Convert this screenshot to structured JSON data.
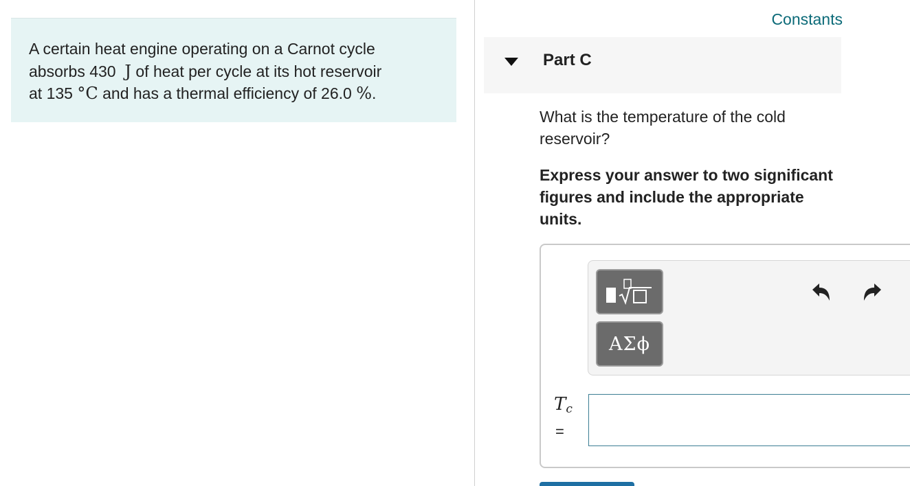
{
  "problem": {
    "line1": "A certain heat engine operating on a Carnot cycle",
    "line2_pre": "absorbs 430",
    "line2_unit": "J",
    "line2_post": "of heat per cycle at its hot reservoir",
    "line3_pre": "at 135",
    "line3_unit": "°C",
    "line3_mid": "and has a thermal efficiency of 26.0",
    "line3_percent": "%",
    "line3_end": "."
  },
  "constants_link": "Constants",
  "part": {
    "title": "Part C",
    "question": "What is the temperature of the cold reservoir?",
    "instruction": "Express your answer to two significant figures and include the appropriate units."
  },
  "answer": {
    "variable": "T",
    "subscript": "c",
    "equals": "=",
    "value": "",
    "symbols_label": "ΑΣϕ"
  },
  "icons": {
    "caret": "caret-down-icon",
    "templates": "templates-icon",
    "undo": "undo-icon",
    "redo": "redo-icon"
  },
  "colors": {
    "problem_bg": "#e6f4f4",
    "link": "#0b6a78",
    "input_border": "#3b7d93",
    "tool_button": "#6b6b6b"
  }
}
